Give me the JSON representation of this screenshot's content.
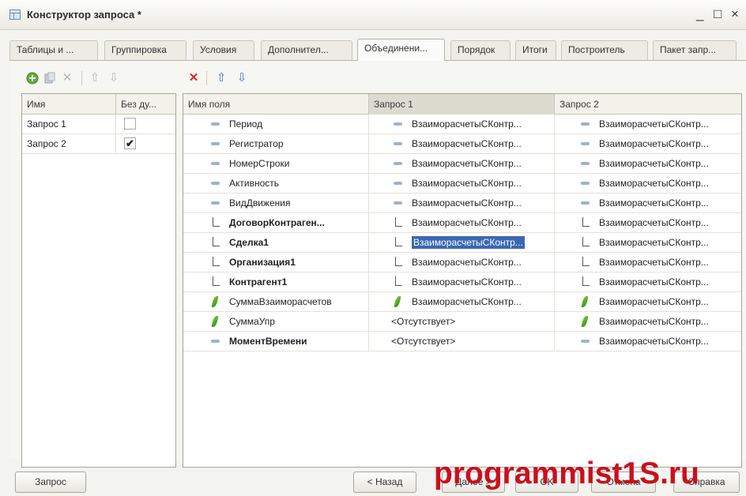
{
  "window": {
    "title": "Конструктор запроса *",
    "minimize": "_",
    "maximize": "□",
    "close": "×"
  },
  "tabs": [
    {
      "label": "Таблицы и ..."
    },
    {
      "label": "Группировка"
    },
    {
      "label": "Условия"
    },
    {
      "label": "Дополнител..."
    },
    {
      "label": "Объединени...",
      "active": true
    },
    {
      "label": "Порядок"
    },
    {
      "label": "Итоги"
    },
    {
      "label": "Построитель"
    },
    {
      "label": "Пакет запр..."
    }
  ],
  "queries": {
    "columns": [
      "Имя",
      "Без ду..."
    ],
    "rows": [
      {
        "name": "Запрос 1",
        "distinct": false
      },
      {
        "name": "Запрос 2",
        "distinct": true
      }
    ]
  },
  "fields": {
    "columns": [
      "Имя поля",
      "Запрос 1",
      "Запрос 2"
    ],
    "rows": [
      {
        "name": "Период",
        "bold": false,
        "icon": "dash",
        "q1": "ВзаиморасчетыСКонтр...",
        "q1icon": "dash",
        "q2": "ВзаиморасчетыСКонтр...",
        "q2icon": "dash"
      },
      {
        "name": "Регистратор",
        "bold": false,
        "icon": "dash",
        "q1": "ВзаиморасчетыСКонтр...",
        "q1icon": "dash",
        "q2": "ВзаиморасчетыСКонтр...",
        "q2icon": "dash"
      },
      {
        "name": "НомерСтроки",
        "bold": false,
        "icon": "dash",
        "q1": "ВзаиморасчетыСКонтр...",
        "q1icon": "dash",
        "q2": "ВзаиморасчетыСКонтр...",
        "q2icon": "dash"
      },
      {
        "name": "Активность",
        "bold": false,
        "icon": "dash",
        "q1": "ВзаиморасчетыСКонтр...",
        "q1icon": "dash",
        "q2": "ВзаиморасчетыСКонтр...",
        "q2icon": "dash"
      },
      {
        "name": "ВидДвижения",
        "bold": false,
        "icon": "dash",
        "q1": "ВзаиморасчетыСКонтр...",
        "q1icon": "dash",
        "q2": "ВзаиморасчетыСКонтр...",
        "q2icon": "dash"
      },
      {
        "name": "ДоговорКонтраген...",
        "bold": true,
        "icon": "ref",
        "q1": "ВзаиморасчетыСКонтр...",
        "q1icon": "ref",
        "q2": "ВзаиморасчетыСКонтр...",
        "q2icon": "ref"
      },
      {
        "name": "Сделка1",
        "bold": true,
        "icon": "ref",
        "q1": "ВзаиморасчетыСКонтр...",
        "q1icon": "ref",
        "q1selected": true,
        "q2": "ВзаиморасчетыСКонтр...",
        "q2icon": "ref"
      },
      {
        "name": "Организация1",
        "bold": true,
        "icon": "ref",
        "q1": "ВзаиморасчетыСКонтр...",
        "q1icon": "ref",
        "q2": "ВзаиморасчетыСКонтр...",
        "q2icon": "ref"
      },
      {
        "name": "Контрагент1",
        "bold": true,
        "icon": "ref",
        "q1": "ВзаиморасчетыСКонтр...",
        "q1icon": "ref",
        "q2": "ВзаиморасчетыСКонтр...",
        "q2icon": "ref"
      },
      {
        "name": "СуммаВзаиморасчетов",
        "bold": false,
        "icon": "num",
        "q1": "ВзаиморасчетыСКонтр...",
        "q1icon": "num",
        "q2": "ВзаиморасчетыСКонтр...",
        "q2icon": "num"
      },
      {
        "name": "СуммаУпр",
        "bold": false,
        "icon": "num",
        "q1": "<Отсутствует>",
        "q1icon": "",
        "q2": "ВзаиморасчетыСКонтр...",
        "q2icon": "num"
      },
      {
        "name": "МоментВремени",
        "bold": true,
        "icon": "dash",
        "q1": "<Отсутствует>",
        "q1icon": "",
        "q2": "ВзаиморасчетыСКонтр...",
        "q2icon": "dash"
      }
    ]
  },
  "buttons": {
    "query": "Запрос",
    "back": "< Назад",
    "next": "Далее >",
    "ok": "OK",
    "cancel": "Отмена",
    "help": "Справка"
  },
  "watermark": "programmist1S.ru",
  "colors": {
    "accent_selection": "#3b67b4",
    "watermark": "#c8101e"
  }
}
